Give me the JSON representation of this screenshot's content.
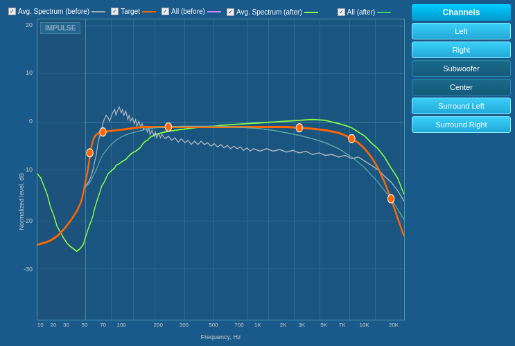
{
  "sidebar": {
    "header": "Channels",
    "buttons": [
      {
        "label": "Left",
        "state": "active"
      },
      {
        "label": "Right",
        "state": "active"
      },
      {
        "label": "Subwoofer",
        "state": "inactive"
      },
      {
        "label": "Center",
        "state": "inactive"
      },
      {
        "label": "Surround Left",
        "state": "active"
      },
      {
        "label": "Surround Right",
        "state": "active"
      }
    ]
  },
  "legend": [
    {
      "checked": true,
      "text": "Avg. Spectrum (before)",
      "color": "#cccccc",
      "type": "line"
    },
    {
      "checked": true,
      "text": "Target",
      "color": "#ff6600",
      "type": "line"
    },
    {
      "checked": true,
      "text": "All (before)",
      "color": "#cc88ff",
      "type": "line"
    },
    {
      "checked": true,
      "text": "Avg. Spectrum (after)",
      "color": "#88ff44",
      "type": "line"
    },
    {
      "checked": true,
      "text": "All (after)",
      "color": "#44cc88",
      "type": "line"
    }
  ],
  "chart": {
    "impulse_label": "IMPULSE",
    "y_axis_label": "Normalized level, dB",
    "x_axis_label": "Frequency, Hz",
    "y_ticks": [
      "20",
      "10",
      "0",
      "-10",
      "-20",
      "-30"
    ],
    "x_ticks": [
      "10",
      "20",
      "30",
      "50",
      "70",
      "100",
      "200",
      "300",
      "500",
      "700",
      "1K",
      "2K",
      "3K",
      "5K",
      "7K",
      "10K",
      "20K"
    ]
  },
  "colors": {
    "accent": "#00ccff",
    "background": "#1a5580",
    "grid": "rgba(100,170,200,0.25)",
    "before_spectrum": "#cccccc",
    "after_spectrum": "#88ff44",
    "target": "#ff6600",
    "all_before": "#cc88ff",
    "all_after": "#44cc88"
  }
}
